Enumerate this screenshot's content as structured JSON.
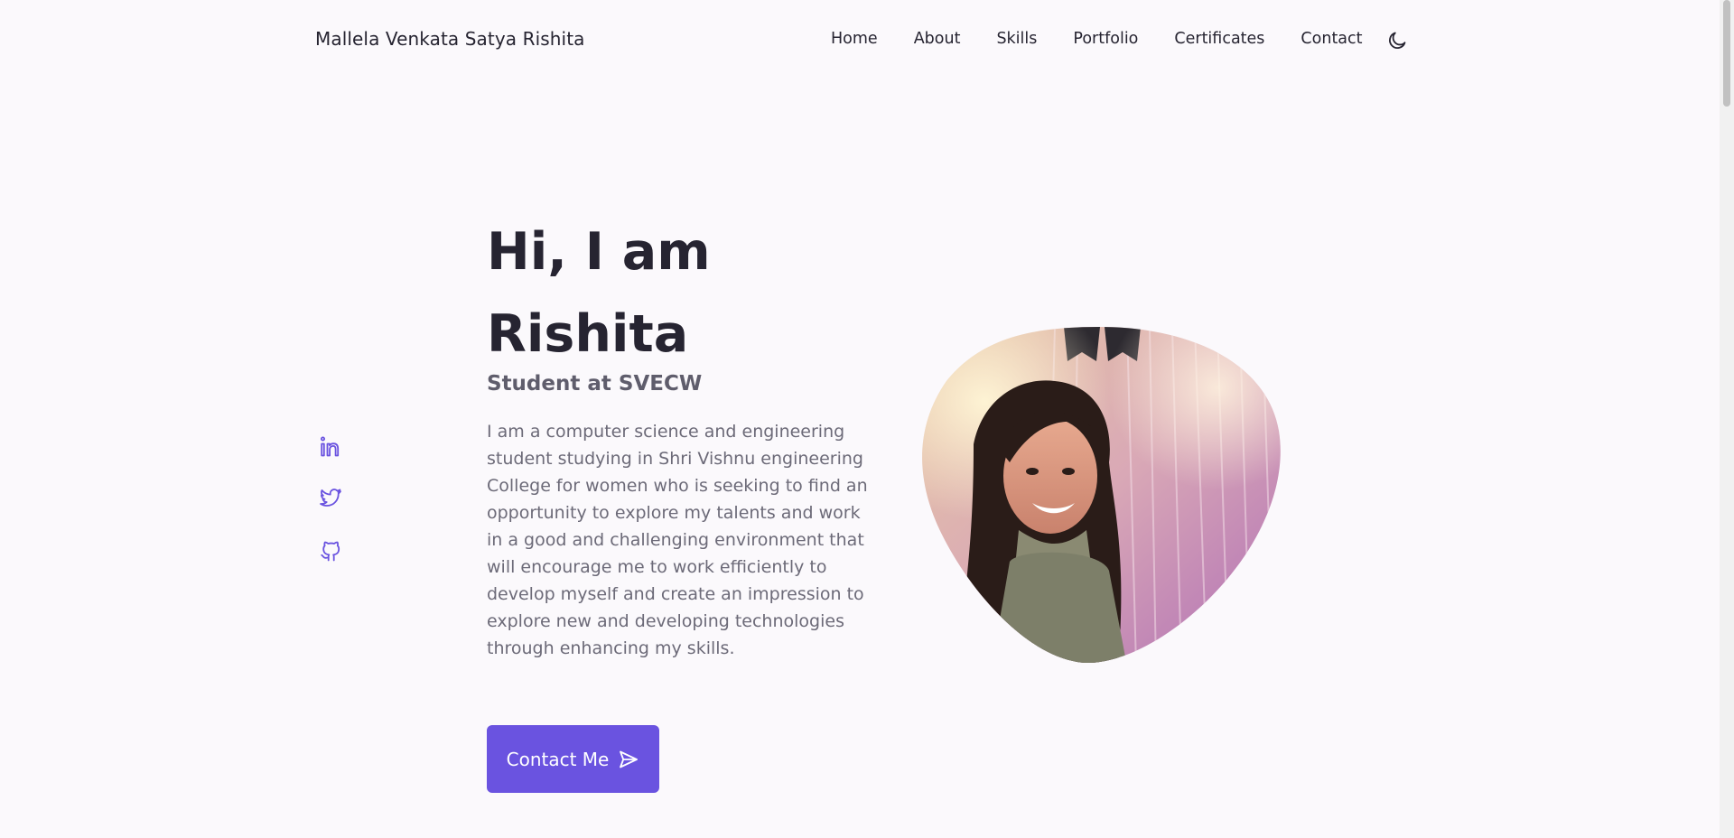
{
  "header": {
    "logo": "Mallela Venkata Satya Rishita",
    "nav": [
      "Home",
      "About",
      "Skills",
      "Portfolio",
      "Certificates",
      "Contact"
    ],
    "theme_icon": "moon-icon"
  },
  "social": {
    "links": [
      "linkedin-icon",
      "twitter-icon",
      "github-icon"
    ],
    "color": "#6a53e0"
  },
  "hero": {
    "title_line1": "Hi, I am",
    "title_line2": "Rishita",
    "subtitle": "Student at SVECW",
    "description": "I am a computer science and engineering student studying in Shri Vishnu engineering College for women who is seeking to find an opportunity to explore my talents and work in a good and challenging environment that will encourage me to work efficiently to develop myself and create an impression to explore new and developing technologies through enhancing my skills.",
    "button_label": "Contact Me",
    "button_icon": "send-icon",
    "accent_color": "#6a53e0"
  }
}
